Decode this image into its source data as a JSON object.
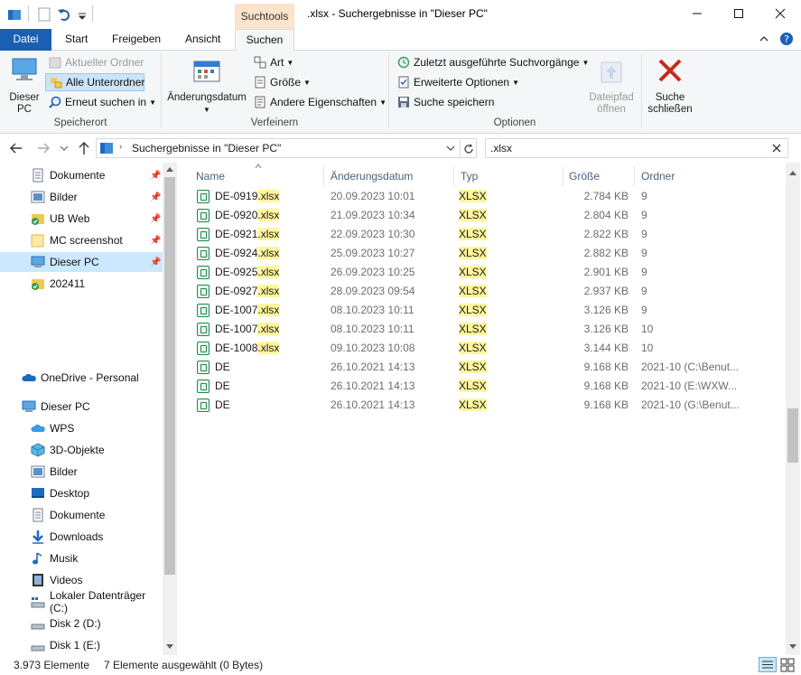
{
  "window": {
    "contextual_tab": "Suchtools",
    "title": ".xlsx - Suchergebnisse in \"Dieser PC\""
  },
  "ribbon_tabs": [
    "Datei",
    "Start",
    "Freigeben",
    "Ansicht",
    "Suchen"
  ],
  "ribbon": {
    "speicherort": {
      "label": "Speicherort",
      "dieser_pc": [
        "Dieser",
        "PC"
      ],
      "aktueller_ordner": "Aktueller Ordner",
      "alle_unterordner": "Alle Unterordner",
      "erneut_suchen": "Erneut suchen in"
    },
    "verfeinern": {
      "label": "Verfeinern",
      "aenderungsdatum": "Änderungsdatum",
      "art": "Art",
      "groesse": "Größe",
      "andere": "Andere Eigenschaften"
    },
    "optionen": {
      "label": "Optionen",
      "zuletzt": "Zuletzt ausgeführte Suchvorgänge",
      "erweiterte": "Erweiterte Optionen",
      "speichern": "Suche speichern",
      "dateipfad": [
        "Dateipfad",
        "öffnen"
      ],
      "schliessen": [
        "Suche",
        "schließen"
      ]
    }
  },
  "address": {
    "path": "Suchergebnisse in \"Dieser PC\"",
    "search_value": ".xlsx"
  },
  "sidebar": {
    "quick_access": [
      {
        "label": "Dokumente",
        "icon": "document-icon",
        "pinned": true
      },
      {
        "label": "Bilder",
        "icon": "picture-icon",
        "pinned": true
      },
      {
        "label": "UB Web",
        "icon": "folder-sync-icon",
        "pinned": true
      },
      {
        "label": "MC screenshot",
        "icon": "folder-icon",
        "pinned": true
      },
      {
        "label": "Dieser PC",
        "icon": "computer-icon",
        "pinned": true
      },
      {
        "label": "202411",
        "icon": "folder-sync-icon",
        "pinned": false
      }
    ],
    "onedrive": "OneDrive - Personal",
    "this_pc": "Dieser PC",
    "pc_items": [
      {
        "label": "WPS",
        "icon": "cloud-icon"
      },
      {
        "label": "3D-Objekte",
        "icon": "cube-icon"
      },
      {
        "label": "Bilder",
        "icon": "picture-icon"
      },
      {
        "label": "Desktop",
        "icon": "desktop-icon"
      },
      {
        "label": "Dokumente",
        "icon": "document-icon"
      },
      {
        "label": "Downloads",
        "icon": "download-icon"
      },
      {
        "label": "Musik",
        "icon": "music-icon"
      },
      {
        "label": "Videos",
        "icon": "video-icon"
      },
      {
        "label": "Lokaler Datenträger (C:)",
        "icon": "drive-icon"
      },
      {
        "label": "Disk 2 (D:)",
        "icon": "drive-icon"
      },
      {
        "label": "Disk 1 (E:)",
        "icon": "drive-icon"
      }
    ]
  },
  "columns": [
    "Name",
    "Änderungsdatum",
    "Typ",
    "Größe",
    "Ordner"
  ],
  "files": [
    {
      "name": "DE-0919",
      "ext": ".xlsx",
      "date": "20.09.2023 10:01",
      "type": "XLSX",
      "size": "2.784 KB",
      "folder": "9"
    },
    {
      "name": "DE-0920",
      "ext": ".xlsx",
      "date": "21.09.2023 10:34",
      "type": "XLSX",
      "size": "2.804 KB",
      "folder": "9"
    },
    {
      "name": "DE-0921",
      "ext": ".xlsx",
      "date": "22.09.2023 10:30",
      "type": "XLSX",
      "size": "2.822 KB",
      "folder": "9"
    },
    {
      "name": "DE-0924",
      "ext": ".xlsx",
      "date": "25.09.2023 10:27",
      "type": "XLSX",
      "size": "2.882 KB",
      "folder": "9"
    },
    {
      "name": "DE-0925",
      "ext": ".xlsx",
      "date": "26.09.2023 10:25",
      "type": "XLSX",
      "size": "2.901 KB",
      "folder": "9"
    },
    {
      "name": "DE-0927",
      "ext": ".xlsx",
      "date": "28.09.2023 09:54",
      "type": "XLSX",
      "size": "2.937 KB",
      "folder": "9"
    },
    {
      "name": "DE-1007",
      "ext": ".xlsx",
      "date": "08.10.2023 10:11",
      "type": "XLSX",
      "size": "3.126 KB",
      "folder": "9"
    },
    {
      "name": "DE-1007",
      "ext": ".xlsx",
      "date": "08.10.2023 10:11",
      "type": "XLSX",
      "size": "3.126 KB",
      "folder": "10"
    },
    {
      "name": "DE-1008",
      "ext": ".xlsx",
      "date": "09.10.2023 10:08",
      "type": "XLSX",
      "size": "3.144 KB",
      "folder": "10"
    },
    {
      "name": "DE",
      "ext": "",
      "date": "26.10.2021 14:13",
      "type": "XLSX",
      "size": "9.168 KB",
      "folder": "2021-10 (C:\\Benut..."
    },
    {
      "name": "DE",
      "ext": "",
      "date": "26.10.2021 14:13",
      "type": "XLSX",
      "size": "9.168 KB",
      "folder": "2021-10 (E:\\WXW..."
    },
    {
      "name": "DE",
      "ext": "",
      "date": "26.10.2021 14:13",
      "type": "XLSX",
      "size": "9.168 KB",
      "folder": "2021-10 (G:\\Benut..."
    }
  ],
  "status": {
    "count": "3.973 Elemente",
    "selected": "7 Elemente ausgewählt (0 Bytes)"
  },
  "colors": {
    "accent": "#1a5fb4",
    "contextual": "#fbe3cc",
    "highlight": "#fff69d",
    "selection": "#cce8ff",
    "excel_green": "#1e8a4a"
  }
}
